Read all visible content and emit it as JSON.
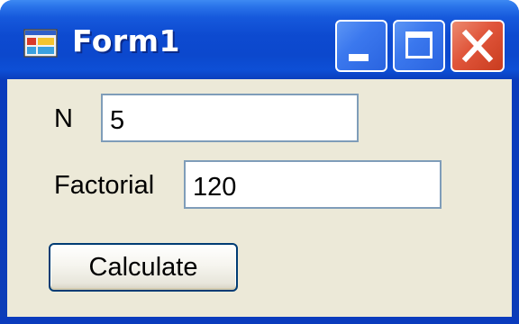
{
  "window": {
    "title": "Form1",
    "icon": "app-form-icon",
    "controls": {
      "minimize": "minimize-icon",
      "maximize": "maximize-icon",
      "close": "close-icon"
    },
    "colors": {
      "titlebar": "#0c48cd",
      "close_button": "#e0553a",
      "client_background": "#ece9d8",
      "textbox_border": "#7f9db9",
      "button_border": "#003c74"
    }
  },
  "form": {
    "n_label": "N",
    "n_value": "5",
    "factorial_label": "Factorial",
    "factorial_value": "120",
    "calculate_label": "Calculate"
  }
}
